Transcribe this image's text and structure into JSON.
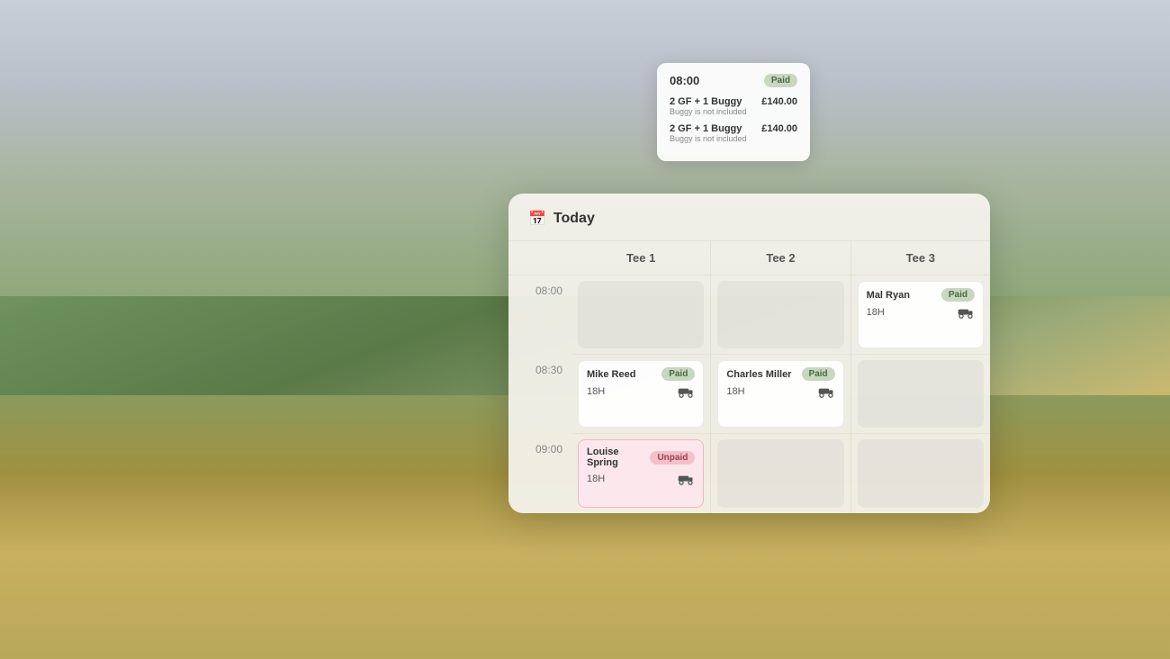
{
  "background": {
    "description": "Golf course landscape"
  },
  "tooltip": {
    "time": "08:00",
    "badge": "Paid",
    "items": [
      {
        "title": "2 GF + 1 Buggy",
        "subtitle": "Buggy is not included",
        "price": "£140.00"
      },
      {
        "title": "2 GF + 1 Buggy",
        "subtitle": "Buggy is not included",
        "price": "£140.00"
      }
    ]
  },
  "panel": {
    "title": "Today",
    "calendar_icon": "📅",
    "tees": [
      {
        "label": "Tee 1"
      },
      {
        "label": "Tee 2"
      },
      {
        "label": "Tee 3"
      }
    ],
    "time_slots": [
      {
        "time": "08:00"
      },
      {
        "time": "08:30"
      },
      {
        "time": "09:00"
      }
    ],
    "bookings": {
      "tee1": [
        {
          "time_index": 0,
          "empty": true
        },
        {
          "time_index": 1,
          "name": "Mike Reed",
          "status": "Paid",
          "holes": "18H",
          "buggy": true
        },
        {
          "time_index": 2,
          "name": "Louise Spring",
          "status": "Unpaid",
          "holes": "18H",
          "buggy": true
        }
      ],
      "tee2": [
        {
          "time_index": 0,
          "empty": true
        },
        {
          "time_index": 1,
          "name": "Charles Miller",
          "status": "Paid",
          "holes": "18H",
          "buggy": true
        },
        {
          "time_index": 2,
          "empty": true
        }
      ],
      "tee3": [
        {
          "time_index": 0,
          "name": "Mal Ryan",
          "status": "Paid",
          "holes": "18H",
          "buggy": true
        },
        {
          "time_index": 1,
          "empty": true
        },
        {
          "time_index": 2,
          "empty": true
        }
      ]
    }
  }
}
